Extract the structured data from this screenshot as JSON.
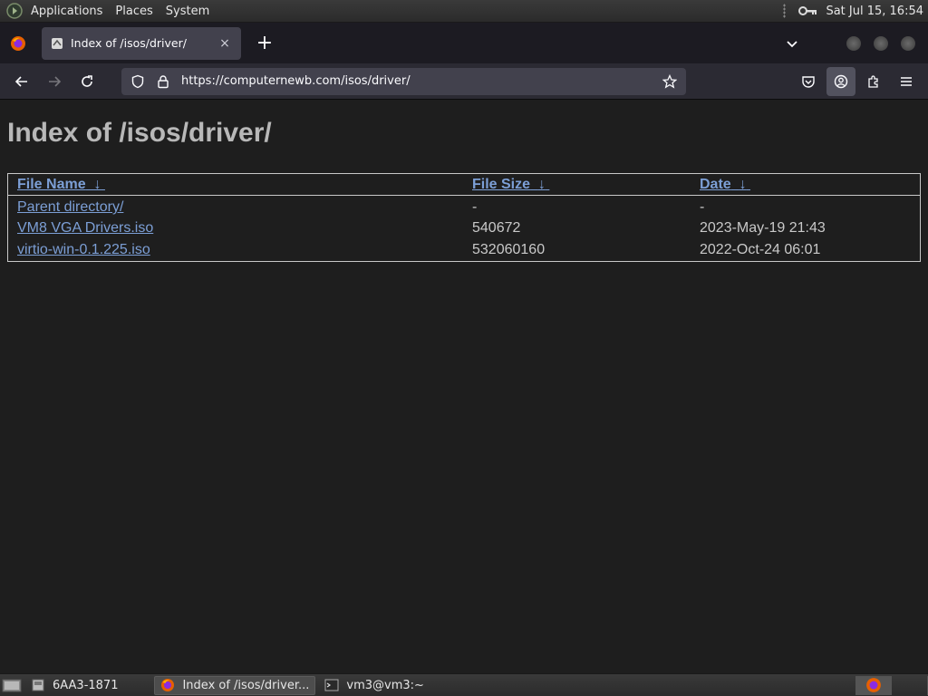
{
  "top_panel": {
    "menus": [
      "Applications",
      "Places",
      "System"
    ],
    "clock": "Sat Jul 15, 16:54"
  },
  "browser": {
    "tab": {
      "title": "Index of /isos/driver/",
      "close": "×"
    },
    "new_tab": "+",
    "url": "https://computernewb.com/isos/driver/"
  },
  "page": {
    "title": "Index of /isos/driver/",
    "headers": {
      "name": "File Name",
      "size": "File Size",
      "date": "Date",
      "sort_arrow": "↓"
    },
    "rows": [
      {
        "name": "Parent directory/",
        "size": "-",
        "date": "-"
      },
      {
        "name": "VM8 VGA Drivers.iso",
        "size": "540672",
        "date": "2023-May-19 21:43"
      },
      {
        "name": "virtio-win-0.1.225.iso",
        "size": "532060160",
        "date": "2022-Oct-24 06:01"
      }
    ]
  },
  "bottom_panel": {
    "tasks": [
      {
        "label": "6AA3-1871",
        "icon": "disk-icon"
      },
      {
        "label": "Index of /isos/driver...",
        "icon": "firefox-icon"
      },
      {
        "label": "vm3@vm3:~",
        "icon": "terminal-icon"
      }
    ]
  }
}
